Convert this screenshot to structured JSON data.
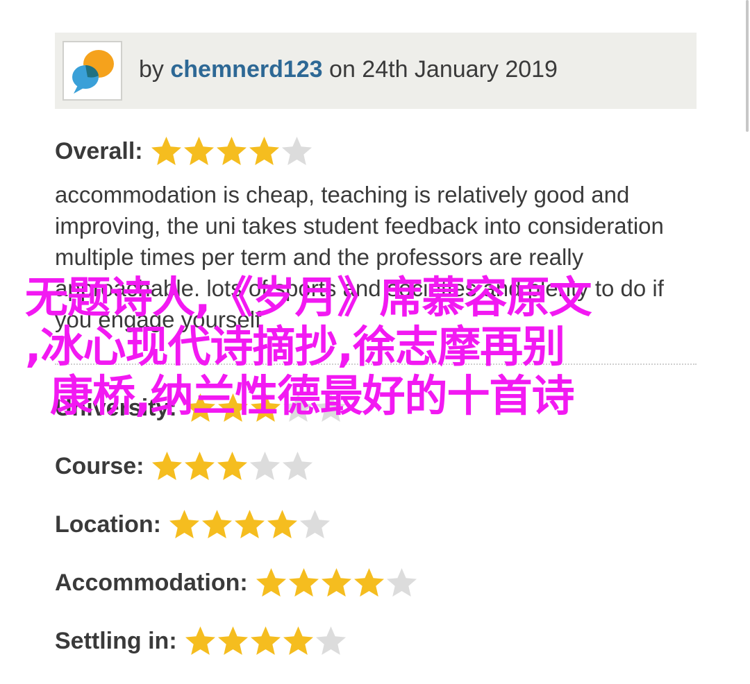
{
  "header": {
    "by_prefix": "by ",
    "author": "chemnerd123",
    "date_text": " on 24th January 2019",
    "avatar_icon": "speech-bubbles-icon",
    "author_color": "#2d6895",
    "background": "#eeeeea"
  },
  "overall": {
    "label": "Overall:",
    "stars": 4,
    "max": 5
  },
  "review": {
    "text": "accommodation is cheap, teaching is relatively good and improving, the uni takes student feedback into consideration multiple times per term and the professors are really approachable. lots of sports and societies and plenty to do if you engage yourself"
  },
  "categories": [
    {
      "label": "University:",
      "stars": 3,
      "max": 5
    },
    {
      "label": "Course:",
      "stars": 3,
      "max": 5
    },
    {
      "label": "Location:",
      "stars": 4,
      "max": 5
    },
    {
      "label": "Accommodation:",
      "stars": 4,
      "max": 5
    },
    {
      "label": "Settling in:",
      "stars": 4,
      "max": 5
    }
  ],
  "overlay": {
    "lines": [
      "无题诗人,《岁月》席慕容原文",
      ",冰心现代诗摘抄,徐志摩再别",
      "康桥,纳兰性德最好的十首诗"
    ],
    "color": "#f219f2"
  },
  "colors": {
    "star_filled": "#f5bd1f",
    "star_empty": "#dcdcdc",
    "text": "#3a3a3a"
  }
}
